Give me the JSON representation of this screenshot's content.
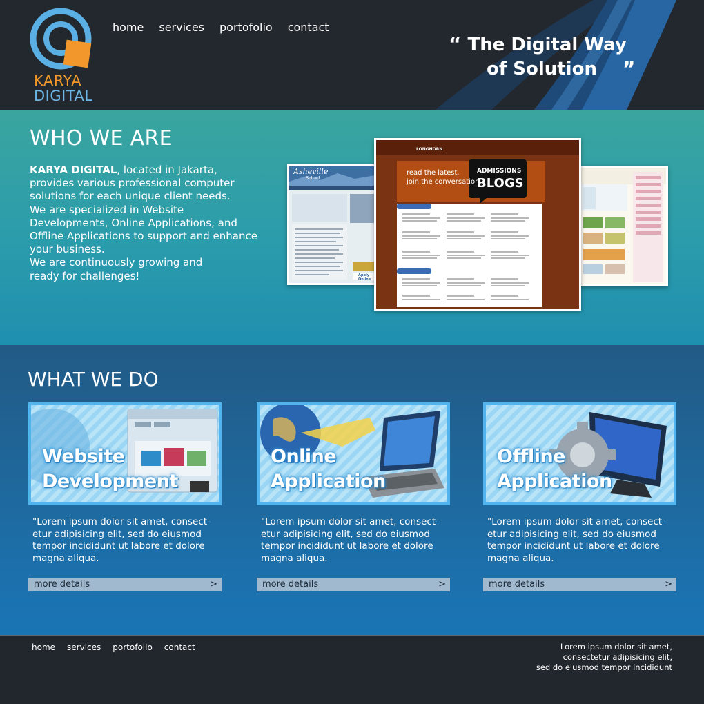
{
  "brand": {
    "line1": "KARYA",
    "line2": "DIGITAL"
  },
  "nav": [
    "home",
    "services",
    "portofolio",
    "contact"
  ],
  "slogan": {
    "open_quote": "“",
    "line1": "The Digital Way",
    "line2": "of Solution",
    "close_quote": "”"
  },
  "who": {
    "title": "WHO WE ARE",
    "company": "KARYA DIGITAL",
    "text": ", located in Jakarta, provides various professional computer solutions for each unique client needs.\nWe are specialized in Website Developments, Online Applications, and Offline Applications to support and enhance your business.\nWe are continuously growing and\nready for challenges!",
    "shots": {
      "left": {
        "title": "Asheville",
        "sub": "School",
        "button": "Apply Online"
      },
      "center": {
        "brand": "LONGHORN",
        "tag1": "read the latest.",
        "tag2": "join the conversation.",
        "box1": "ADMISSIONS",
        "box2": "BLOGS"
      }
    }
  },
  "what": {
    "title": "WHAT WE DO",
    "cards": [
      {
        "title1": "Website",
        "title2": "Development",
        "desc": "\"Lorem ipsum dolor sit amet, consect-etur adipisicing elit, sed do eiusmod tempor incididunt ut labore et dolore magna aliqua.",
        "more": "more details",
        "arrow": ">"
      },
      {
        "title1": "Online",
        "title2": "Application",
        "desc": "\"Lorem ipsum dolor sit amet, consect-etur adipisicing elit, sed do eiusmod tempor incididunt ut labore et dolore magna aliqua.",
        "more": "more details",
        "arrow": ">"
      },
      {
        "title1": "Offline",
        "title2": "Application",
        "desc": "\"Lorem ipsum dolor sit amet, consect-etur adipisicing elit, sed do eiusmod tempor incididunt ut labore et dolore magna aliqua.",
        "more": "more details",
        "arrow": ">"
      }
    ]
  },
  "footer": {
    "nav": [
      "home",
      "services",
      "portofolio",
      "contact"
    ],
    "text": "Lorem ipsum dolor sit amet,\nconsectetur adipisicing elit,\nsed do eiusmod tempor incididunt"
  },
  "colors": {
    "header_bg": "#23282f",
    "teal": "#3aa59f",
    "blue": "#1e6aa0",
    "orange": "#f2972b",
    "logo_blue": "#6bb6e6"
  }
}
